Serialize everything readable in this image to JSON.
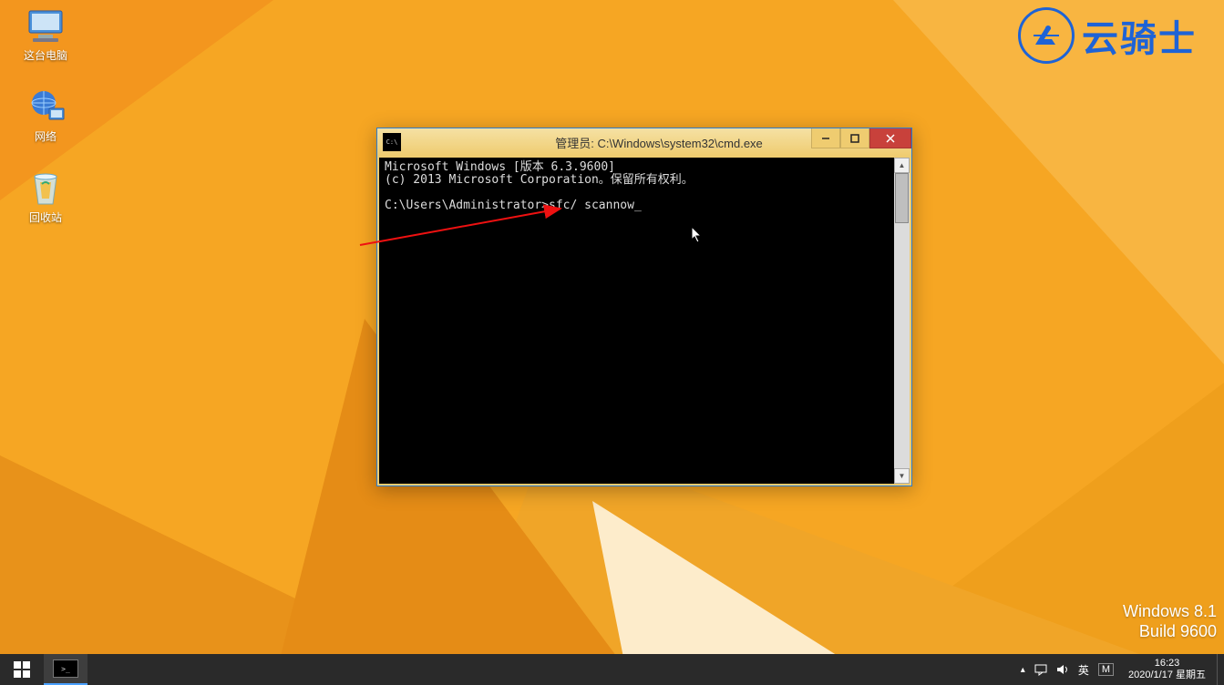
{
  "desktop": {
    "icons": [
      {
        "name": "this-pc",
        "label": "这台电脑"
      },
      {
        "name": "network",
        "label": "网络"
      },
      {
        "name": "recycle-bin",
        "label": "回收站"
      }
    ]
  },
  "brand": {
    "text": "云骑士"
  },
  "watermark": {
    "line1": "Windows 8.1",
    "line2": "Build 9600"
  },
  "cmd": {
    "title": "管理员: C:\\Windows\\system32\\cmd.exe",
    "line1": "Microsoft Windows [版本 6.3.9600]",
    "line2": "(c) 2013 Microsoft Corporation。保留所有权利。",
    "prompt": "C:\\Users\\Administrator>",
    "command": "sfc/ scannow"
  },
  "tray": {
    "lang": "英",
    "ime": "M",
    "time": "16:23",
    "date": "2020/1/17 星期五"
  }
}
